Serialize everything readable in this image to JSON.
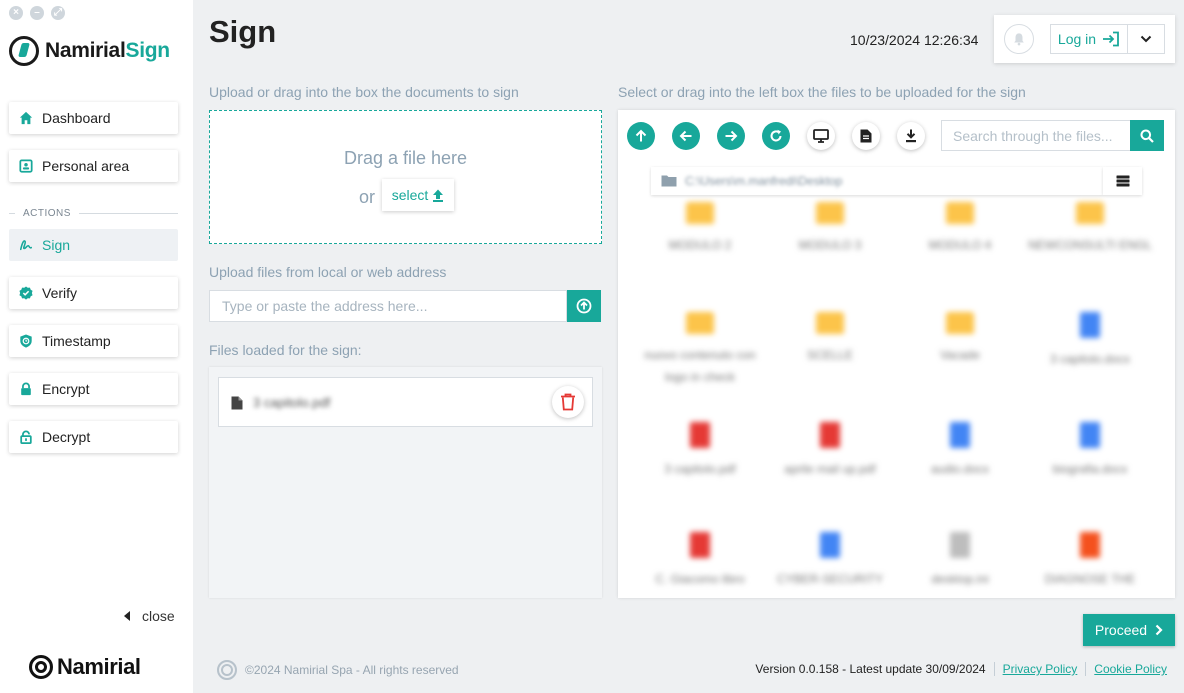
{
  "window": {
    "controls": [
      "×",
      "–",
      "⤢"
    ]
  },
  "brand": {
    "name_main": "Namirial",
    "name_accent": "Sign",
    "footer_logo": "Namirial"
  },
  "sidebar": {
    "items": [
      {
        "label": "Dashboard",
        "icon": "home-icon"
      },
      {
        "label": "Personal area",
        "icon": "id-card-icon"
      }
    ],
    "section_label": "ACTIONS",
    "actions": [
      {
        "label": "Sign",
        "icon": "signature-icon",
        "active": true
      },
      {
        "label": "Verify",
        "icon": "check-badge-icon"
      },
      {
        "label": "Timestamp",
        "icon": "shield-clock-icon"
      },
      {
        "label": "Encrypt",
        "icon": "lock-icon"
      },
      {
        "label": "Decrypt",
        "icon": "unlock-icon"
      }
    ],
    "close_label": "close"
  },
  "header": {
    "title": "Sign",
    "datetime": "10/23/2024 12:26:34",
    "login_label": "Log in"
  },
  "upload": {
    "drop_label": "Upload or drag into the box the documents to sign",
    "drop_text": "Drag a file here",
    "or_text": "or",
    "select_label": "select",
    "url_label": "Upload files from local or web address",
    "url_placeholder": "Type or paste the address here...",
    "files_label": "Files loaded for the sign:",
    "files": [
      {
        "name": "3 capitolo.pdf"
      }
    ]
  },
  "browser": {
    "label": "Select or drag into the left box the files to be uploaded for the sign",
    "search_placeholder": "Search through the files...",
    "path": "C:\\Users\\m.manfredi\\Desktop",
    "tiles": [
      {
        "type": "folder",
        "name": "MODULO 2"
      },
      {
        "type": "folder",
        "name": "MODULO 3"
      },
      {
        "type": "folder",
        "name": "MODULO 4"
      },
      {
        "type": "folder",
        "name": "NEWCONSULTI ENGL"
      },
      {
        "type": "folder",
        "name": "nuovo contenuto con logo in check"
      },
      {
        "type": "folder",
        "name": "SCELLE"
      },
      {
        "type": "folder",
        "name": "Vacade"
      },
      {
        "type": "doc",
        "name": "3 capitolo.docx"
      },
      {
        "type": "pdf",
        "name": "3 capitolo.pdf"
      },
      {
        "type": "pdf",
        "name": "aprile mail up.pdf"
      },
      {
        "type": "doc",
        "name": "audio.docx"
      },
      {
        "type": "doc",
        "name": "biografia.docx"
      },
      {
        "type": "pdf",
        "name": "C. Giacomo libro"
      },
      {
        "type": "doc",
        "name": "CYBER-SECURITY"
      },
      {
        "type": "gen",
        "name": "desktop.ini"
      },
      {
        "type": "ppt",
        "name": "DIAGNOSE THE"
      }
    ]
  },
  "actions": {
    "proceed_label": "Proceed"
  },
  "footer": {
    "copyright": "©2024 Namirial Spa - All rights reserved",
    "version": "Version 0.0.158 - Latest update 30/09/2024",
    "privacy": "Privacy Policy",
    "cookie": "Cookie Policy"
  },
  "colors": {
    "accent": "#18a89a",
    "muted": "#8da2b3",
    "danger": "#e53935"
  }
}
